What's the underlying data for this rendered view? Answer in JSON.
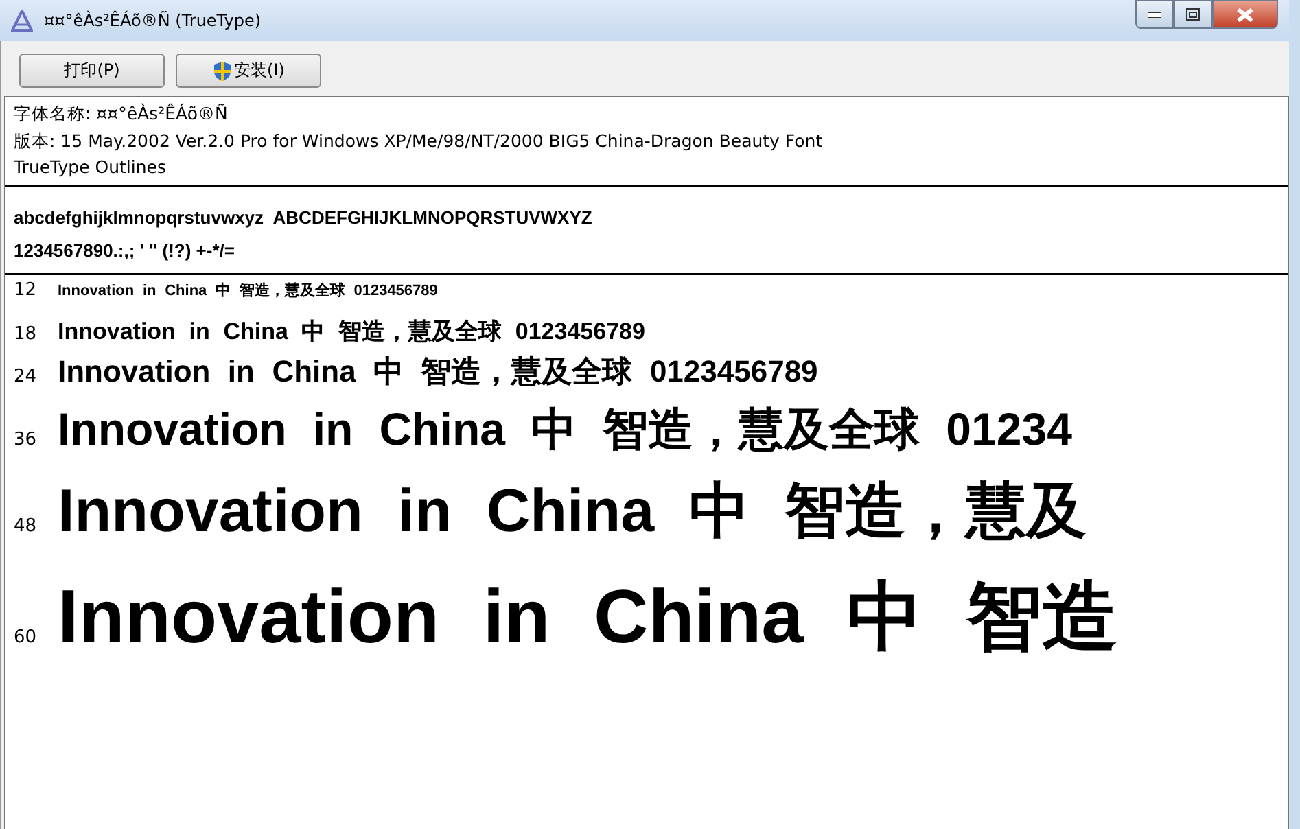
{
  "window": {
    "title": "¤¤°êÀs²ÊÁõ®Ñ (TrueType)"
  },
  "toolbar": {
    "buttons": [
      {
        "kind": "print",
        "label": "打印(P)"
      },
      {
        "kind": "install",
        "label": "安装(I)"
      }
    ]
  },
  "font_info": {
    "lines": [
      "字体名称: ¤¤°êÀs²ÊÁõ®Ñ",
      "版本: 15 May.2002 Ver.2.0 Pro for Windows XP/Me/98/NT/2000 BIG5 China-Dragon Beauty Font",
      "TrueType Outlines"
    ]
  },
  "charset": [
    "abcdefghijklmnopqrstuvwxyz  ABCDEFGHIJKLMNOPQRSTUVWXYZ",
    "1234567890.:,; ' \" (!?) +-*/="
  ],
  "samples": [
    {
      "size": "12",
      "text": "Innovation in China 中 智造，慧及全球 0123456789"
    },
    {
      "size": "18",
      "text": "Innovation in China 中 智造，慧及全球 0123456789"
    },
    {
      "size": "24",
      "text": "Innovation in China 中 智造，慧及全球 0123456789"
    },
    {
      "size": "36",
      "text": "Innovation in China 中 智造，慧及全球 01234"
    },
    {
      "size": "48",
      "text": "Innovation in China 中 智造，慧及"
    },
    {
      "size": "60",
      "text": "Innovation in China 中 智造"
    }
  ]
}
